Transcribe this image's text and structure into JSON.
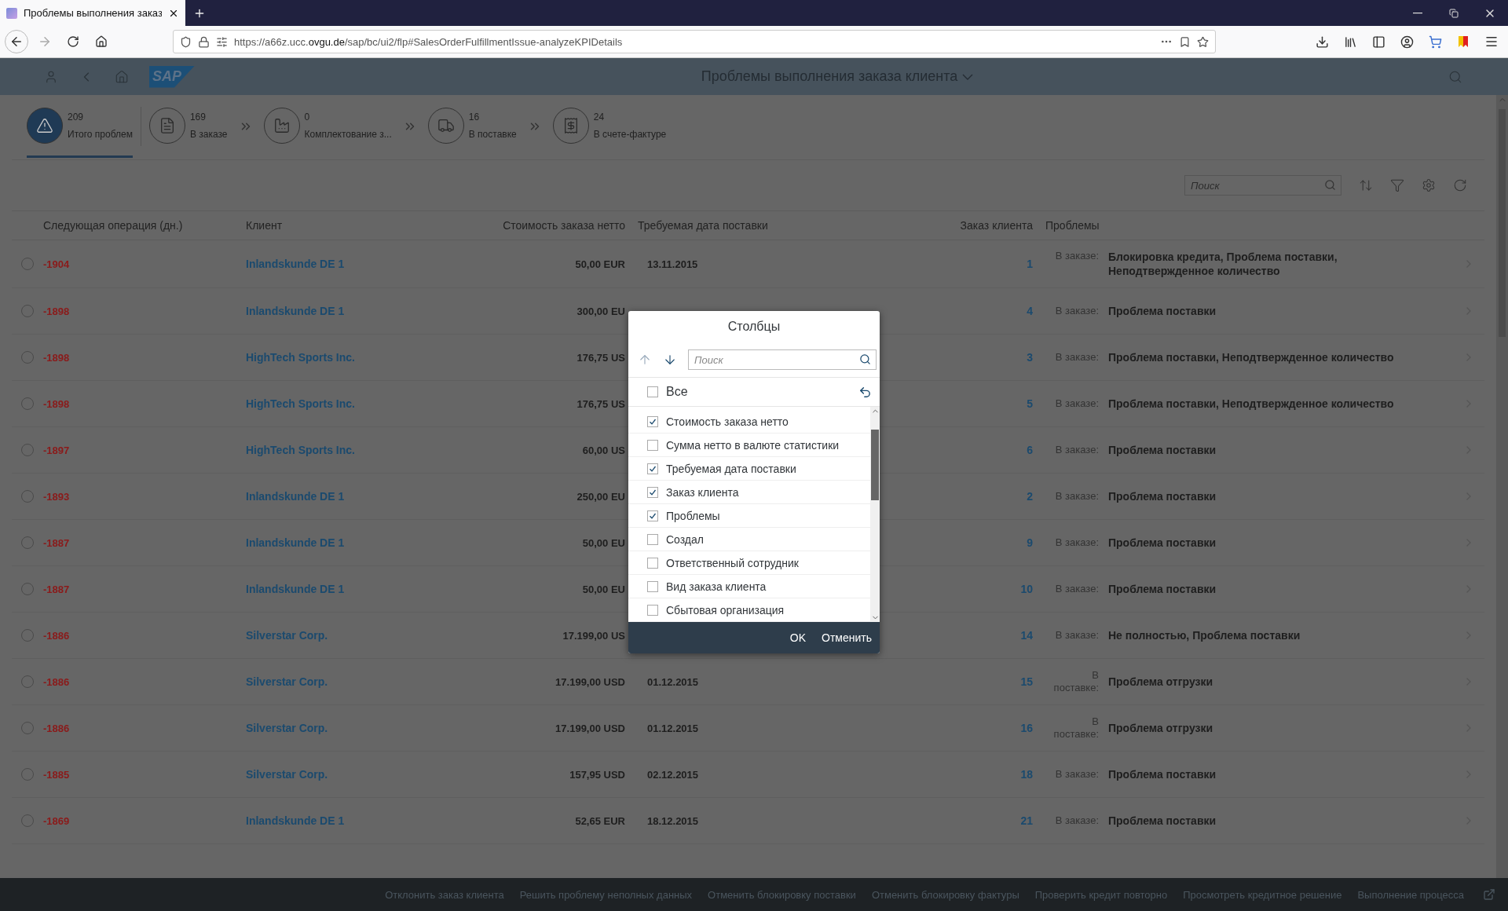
{
  "browser": {
    "tab_title": "Проблемы выполнения заказ",
    "url_host": "https://a66z.ucc.",
    "url_domain": "ovgu.de",
    "url_path": "/sap/bc/ui2/flp#SalesOrderFulfillmentIssue-analyzeKPIDetails"
  },
  "shell": {
    "logo": "SAP",
    "title": "Проблемы выполнения заказа клиента"
  },
  "kpi_tabs": [
    {
      "count": "209",
      "label": "Итого проблем",
      "kind": "alert",
      "selected": true
    },
    {
      "count": "169",
      "label": "В заказе",
      "kind": "order",
      "selected": false
    },
    {
      "count": "0",
      "label": "Комплектование з...",
      "kind": "factory",
      "selected": false
    },
    {
      "count": "16",
      "label": "В поставке",
      "kind": "truck",
      "selected": false
    },
    {
      "count": "24",
      "label": "В счете-фактуре",
      "kind": "invoice",
      "selected": false
    }
  ],
  "table_search": {
    "placeholder": "Поиск"
  },
  "columns": [
    "Следующая операция (дн.)",
    "Клиент",
    "Стоимость заказа нетто",
    "Требуемая дата поставки",
    "Заказ клиента",
    "Проблемы"
  ],
  "rows": [
    {
      "selected": false,
      "next_op": "-1904",
      "client": "Inlandskunde DE 1",
      "amount": "50,00 EUR",
      "date": "13.11.2015",
      "order": "1",
      "problem_label": "В заказе:",
      "problems": "Блокировка кредита, Проблема поставки, Неподтвержденное количество"
    },
    {
      "selected": false,
      "next_op": "-1898",
      "client": "Inlandskunde DE 1",
      "amount": "300,00 EU",
      "order": "4",
      "problem_label": "В заказе:",
      "problems": "Проблема поставки"
    },
    {
      "selected": false,
      "next_op": "-1898",
      "client": "HighTech Sports Inc.",
      "amount": "176,75 US",
      "order": "3",
      "problem_label": "В заказе:",
      "problems": "Проблема поставки, Неподтвержденное количество"
    },
    {
      "selected": false,
      "next_op": "-1898",
      "client": "HighTech Sports Inc.",
      "amount": "176,75 US",
      "order": "5",
      "problem_label": "В заказе:",
      "problems": "Проблема поставки, Неподтвержденное количество"
    },
    {
      "selected": false,
      "next_op": "-1897",
      "client": "HighTech Sports Inc.",
      "amount": "60,00 US",
      "order": "6",
      "problem_label": "В заказе:",
      "problems": "Проблема поставки"
    },
    {
      "selected": false,
      "next_op": "-1893",
      "client": "Inlandskunde DE 1",
      "amount": "250,00 EU",
      "order": "2",
      "problem_label": "В заказе:",
      "problems": "Проблема поставки"
    },
    {
      "selected": false,
      "next_op": "-1887",
      "client": "Inlandskunde DE 1",
      "amount": "50,00 EU",
      "order": "9",
      "problem_label": "В заказе:",
      "problems": "Проблема поставки"
    },
    {
      "selected": false,
      "next_op": "-1887",
      "client": "Inlandskunde DE 1",
      "amount": "50,00 EU",
      "order": "10",
      "problem_label": "В заказе:",
      "problems": "Проблема поставки"
    },
    {
      "selected": false,
      "next_op": "-1886",
      "client": "Silverstar Corp.",
      "amount": "17.199,00 US",
      "order": "14",
      "problem_label": "В заказе:",
      "problems": "Не полностью, Проблема поставки"
    },
    {
      "selected": false,
      "next_op": "-1886",
      "client": "Silverstar Corp.",
      "amount": "17.199,00 USD",
      "date": "01.12.2015",
      "order": "15",
      "problem_label": "В поставке:",
      "problems": "Проблема отгрузки"
    },
    {
      "selected": false,
      "next_op": "-1886",
      "client": "Silverstar Corp.",
      "amount": "17.199,00 USD",
      "date": "01.12.2015",
      "order": "16",
      "problem_label": "В поставке:",
      "problems": "Проблема отгрузки"
    },
    {
      "selected": false,
      "next_op": "-1885",
      "client": "Silverstar Corp.",
      "amount": "157,95 USD",
      "date": "02.12.2015",
      "order": "18",
      "problem_label": "В заказе:",
      "problems": "Проблема поставки"
    },
    {
      "selected": false,
      "next_op": "-1869",
      "client": "Inlandskunde DE 1",
      "amount": "52,65 EUR",
      "date": "18.12.2015",
      "order": "21",
      "problem_label": "В заказе:",
      "problems": "Проблема поставки"
    }
  ],
  "dialog": {
    "title": "Столбцы",
    "search_placeholder": "Поиск",
    "all": {
      "label": "Все",
      "checked": false
    },
    "items": [
      {
        "label": "Стоимость заказа нетто",
        "checked": true
      },
      {
        "label": "Сумма нетто в валюте статистики",
        "checked": false
      },
      {
        "label": "Требуемая дата поставки",
        "checked": true
      },
      {
        "label": "Заказ клиента",
        "checked": true
      },
      {
        "label": "Проблемы",
        "checked": true
      },
      {
        "label": "Создал",
        "checked": false
      },
      {
        "label": "Ответственный сотрудник",
        "checked": false
      },
      {
        "label": "Вид заказа клиента",
        "checked": false
      },
      {
        "label": "Сбытовая организация",
        "checked": false
      }
    ],
    "buttons": [
      "OK",
      "Отменить"
    ]
  },
  "footer_actions": [
    "Отклонить заказ клиента",
    "Решить проблему неполных данных",
    "Отменить блокировку поставки",
    "Отменить блокировку фактуры",
    "Проверить кредит повторно",
    "Просмотреть кредитное решение",
    "Выполнение процесса"
  ]
}
